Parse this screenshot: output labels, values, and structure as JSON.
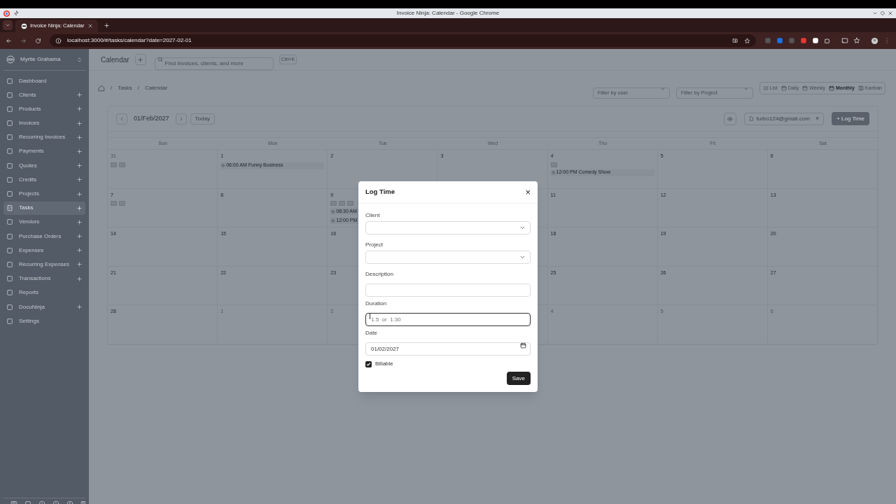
{
  "browser": {
    "window_title": "Invoice Ninja: Calendar - Google Chrome",
    "tab_title": "Invoice Ninja: Calendar",
    "url": "localhost:3000/#/tasks/calendar?date=2027-02-01"
  },
  "sidebar": {
    "account": "Myrtie Grahama",
    "items": [
      {
        "label": "Dashboard",
        "selected": false,
        "addable": false
      },
      {
        "label": "Clients",
        "selected": false,
        "addable": true
      },
      {
        "label": "Products",
        "selected": false,
        "addable": true
      },
      {
        "label": "Invoices",
        "selected": false,
        "addable": true
      },
      {
        "label": "Recurring Invoices",
        "selected": false,
        "addable": true
      },
      {
        "label": "Payments",
        "selected": false,
        "addable": true
      },
      {
        "label": "Quotes",
        "selected": false,
        "addable": true
      },
      {
        "label": "Credits",
        "selected": false,
        "addable": true
      },
      {
        "label": "Projects",
        "selected": false,
        "addable": true
      },
      {
        "label": "Tasks",
        "selected": true,
        "addable": true
      },
      {
        "label": "Vendors",
        "selected": false,
        "addable": true
      },
      {
        "label": "Purchase Orders",
        "selected": false,
        "addable": true
      },
      {
        "label": "Expenses",
        "selected": false,
        "addable": true
      },
      {
        "label": "Recurring Expenses",
        "selected": false,
        "addable": true
      },
      {
        "label": "Transactions",
        "selected": false,
        "addable": true
      },
      {
        "label": "Reports",
        "selected": false,
        "addable": false
      },
      {
        "label": "DocuNinja",
        "selected": false,
        "addable": true
      },
      {
        "label": "Settings",
        "selected": false,
        "addable": false
      }
    ]
  },
  "header": {
    "title": "Calendar",
    "search": {
      "placeholder": "Find invoices, clients, and more",
      "shortcut": "Ctrl+K"
    }
  },
  "breadcrumb": [
    {
      "separator": "/",
      "label": "Tasks"
    },
    {
      "separator": "/",
      "label": "Calendar"
    }
  ],
  "filters": [
    {
      "placeholder": "Filter by user"
    },
    {
      "placeholder": "Filter by Project"
    }
  ],
  "views": [
    {
      "label": "List",
      "selected": false
    },
    {
      "label": "Daily",
      "selected": false
    },
    {
      "label": "Weekly",
      "selected": false
    },
    {
      "label": "Monthly",
      "selected": true
    },
    {
      "label": "Kanban",
      "selected": false
    }
  ],
  "calendar": {
    "date": "01/Feb/2027",
    "today_label": "Today",
    "user_chip": "turbo124@gmail.com",
    "remove_label": "×",
    "log_time_label": "+ Log Time",
    "weekdays": [
      "Sun",
      "Mon",
      "Tue",
      "Wed",
      "Thu",
      "Fri",
      "Sat"
    ],
    "weeks": [
      [
        {
          "day": "31",
          "outside": true,
          "events": [
            {
              "kind": "tag"
            },
            {
              "kind": "tag"
            }
          ]
        },
        {
          "day": "1",
          "outside": false,
          "events": [
            {
              "kind": "entry",
              "time": "06:00 AM",
              "title": "Funny Business"
            }
          ]
        },
        {
          "day": "2",
          "outside": false
        },
        {
          "day": "3",
          "outside": false
        },
        {
          "day": "4",
          "outside": false,
          "events": [
            {
              "kind": "tag"
            },
            {
              "kind": "entry",
              "time": "12:00 PM",
              "title": "Comedy Show"
            }
          ]
        },
        {
          "day": "5",
          "outside": false
        },
        {
          "day": "6",
          "outside": false
        }
      ],
      [
        {
          "day": "7",
          "outside": false,
          "events": [
            {
              "kind": "tag"
            },
            {
              "kind": "tag"
            }
          ]
        },
        {
          "day": "8",
          "outside": false
        },
        {
          "day": "9",
          "outside": false,
          "events": [
            {
              "kind": "tag"
            },
            {
              "kind": "tag"
            },
            {
              "kind": "tag"
            },
            {
              "kind": "entry",
              "time": "08:30 AM"
            },
            {
              "kind": "entry",
              "time": "12:00 PM"
            }
          ]
        },
        {
          "covered": true
        },
        {
          "day": "11",
          "outside": false
        },
        {
          "day": "12",
          "outside": false
        },
        {
          "day": "13",
          "outside": false
        }
      ],
      [
        {
          "day": "14",
          "outside": false
        },
        {
          "day": "15",
          "outside": false
        },
        {
          "day": "16",
          "outside": false
        },
        {
          "covered": true
        },
        {
          "day": "18",
          "outside": false
        },
        {
          "day": "19",
          "outside": false
        },
        {
          "day": "20",
          "outside": false
        }
      ],
      [
        {
          "day": "21",
          "outside": false
        },
        {
          "day": "22",
          "outside": false
        },
        {
          "day": "23",
          "outside": false
        },
        {
          "covered": true
        },
        {
          "day": "25",
          "outside": false
        },
        {
          "day": "26",
          "outside": false
        },
        {
          "day": "27",
          "outside": false
        }
      ],
      [
        {
          "day": "28",
          "outside": false
        },
        {
          "day": "1",
          "outside": true
        },
        {
          "day": "2",
          "outside": true
        },
        {
          "covered": true
        },
        {
          "day": "4",
          "outside": true
        },
        {
          "day": "5",
          "outside": true
        },
        {
          "day": "6",
          "outside": true
        }
      ]
    ]
  },
  "modal": {
    "title": "Log Time",
    "close": "×",
    "fields": [
      {
        "label": "Client",
        "kind": "select",
        "focused": false
      },
      {
        "label": "Project",
        "kind": "select",
        "focused": false
      },
      {
        "label": "Description",
        "kind": "text",
        "focused": false
      },
      {
        "label": "Duration",
        "kind": "text",
        "placeholder": "1.5  or  1:30",
        "focused": true
      },
      {
        "label": "Date",
        "kind": "date",
        "value": "01/02/2027",
        "focused": false
      }
    ],
    "billable": {
      "label": "Billable",
      "checked": true
    },
    "save_label": "Save"
  }
}
